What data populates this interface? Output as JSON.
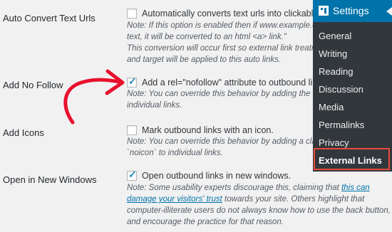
{
  "settings": [
    {
      "label": "Auto Convert Text Urls",
      "checked": false,
      "option_text": "Automatically converts text urls into clickable urls",
      "note_lines": [
        "Note: If this option is enabled then if www.example.com",
        "text, it will be converted to an html <a> link.\"",
        "This conversion will occur first so external link treatment",
        "and target will be applied to this auto links."
      ]
    },
    {
      "label": "Add No Follow",
      "checked": true,
      "option_text": "Add a rel=\"nofollow\" attribute to outbound links.",
      "note_lines": [
        "Note: You can override this behavior by adding the attr",
        "individual links."
      ]
    },
    {
      "label": "Add Icons",
      "checked": false,
      "option_text": "Mark outbound links with an icon.",
      "note_lines": [
        "Note: You can override this behavior by adding a class",
        "`noicon` to individual links."
      ]
    },
    {
      "label": "Open in New Windows",
      "checked": true,
      "option_text": "Open outbound links in new windows.",
      "note_line1_prefix": "Note: Some usability experts discourage this, claiming that ",
      "note_line1_link": "this can",
      "note_line2_link": "damage your visitors' trust",
      "note_line2_suffix": " towards your site. Others highlight that",
      "note_lines_rest": [
        "computer-illiterate users do not always know how to use the back button,",
        "and encourage the practice for that reason."
      ]
    }
  ],
  "admin_menu": {
    "header_label": "Settings",
    "header_icon": "settings-icon",
    "items": [
      {
        "label": "General"
      },
      {
        "label": "Writing"
      },
      {
        "label": "Reading"
      },
      {
        "label": "Discussion"
      },
      {
        "label": "Media"
      },
      {
        "label": "Permalinks"
      },
      {
        "label": "Privacy"
      },
      {
        "label": "External Links"
      }
    ],
    "active_item": "External Links"
  },
  "colors": {
    "menu_header": "#0073aa",
    "menu_bg": "#32373c",
    "highlight_border": "#e74c3c",
    "annotation_arrow": "#e8112d",
    "checkbox_tick": "#1e8cbe"
  }
}
